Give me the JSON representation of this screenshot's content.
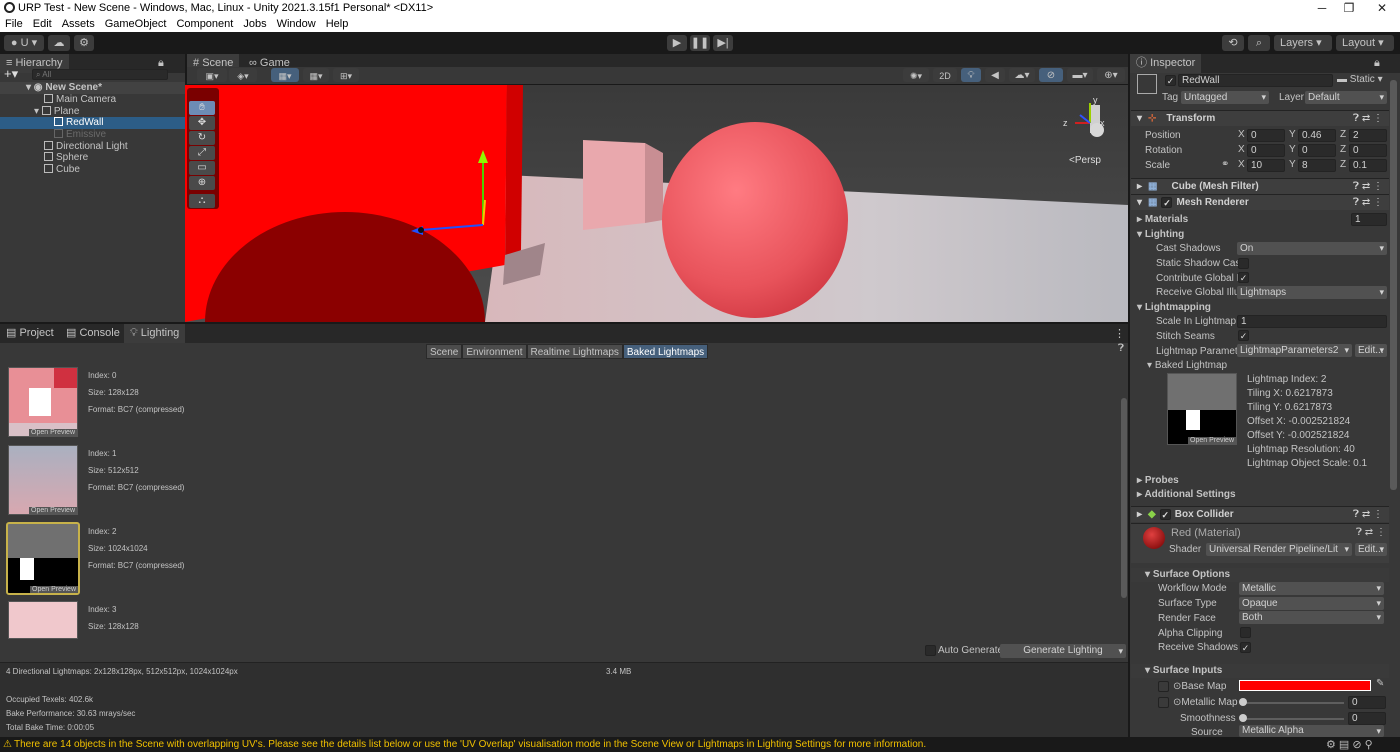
{
  "window": {
    "title": "URP Test - New Scene - Windows, Mac, Linux - Unity 2021.3.15f1 Personal* <DX11>",
    "minimize": "─",
    "maximize": "❐",
    "close": "✕"
  },
  "menu": [
    "File",
    "Edit",
    "Assets",
    "GameObject",
    "Component",
    "Jobs",
    "Window",
    "Help"
  ],
  "toolbar": {
    "account": "U",
    "layers": "Layers",
    "layout": "Layout"
  },
  "hierarchy": {
    "tab": "Hierarchy",
    "search_placeholder": "All",
    "scene": "New Scene*",
    "items": [
      "Main Camera",
      "Plane",
      "RedWall",
      "Emissive",
      "Directional Light",
      "Sphere",
      "Cube"
    ]
  },
  "scene": {
    "tab_scene": "Scene",
    "tab_game": "Game",
    "btn_2d": "2D",
    "persp": "<Persp",
    "axis_y": "y",
    "axis_z": "z",
    "axis_x": "x"
  },
  "bottom": {
    "tabs": [
      "Project",
      "Console",
      "Lighting"
    ],
    "lighting_tabs": [
      "Scene",
      "Environment",
      "Realtime Lightmaps",
      "Baked Lightmaps"
    ],
    "lightmaps": [
      {
        "index": "Index: 0",
        "size": "Size: 128x128",
        "format": "Format: BC7 (compressed)",
        "preview": "Open Preview"
      },
      {
        "index": "Index: 1",
        "size": "Size: 512x512",
        "format": "Format: BC7 (compressed)",
        "preview": "Open Preview"
      },
      {
        "index": "Index: 2",
        "size": "Size: 1024x1024",
        "format": "Format: BC7 (compressed)",
        "preview": "Open Preview"
      },
      {
        "index": "Index: 3",
        "size": "Size: 128x128"
      }
    ],
    "auto_generate": "Auto Generate",
    "generate": "Generate Lighting",
    "summary": "4 Directional Lightmaps: 2x128x128px, 512x512px, 1024x1024px",
    "memory": "3.4 MB",
    "occupied": "Occupied Texels: 402.6k",
    "perf": "Bake Performance: 30.63 mrays/sec",
    "time": "Total Bake Time: 0:00:05"
  },
  "inspector": {
    "tab": "Inspector",
    "name": "RedWall",
    "static": "Static",
    "tag_label": "Tag",
    "tag": "Untagged",
    "layer_label": "Layer",
    "layer": "Default",
    "transform": "Transform",
    "position": "Position",
    "rotation": "Rotation",
    "scale": "Scale",
    "pos": {
      "x": "0",
      "y": "0.46",
      "z": "2"
    },
    "rot": {
      "x": "0",
      "y": "0",
      "z": "0"
    },
    "scl": {
      "x": "10",
      "y": "8",
      "z": "0.1"
    },
    "mesh_filter": "Cube (Mesh Filter)",
    "mesh_renderer": "Mesh Renderer",
    "materials": "Materials",
    "materials_count": "1",
    "lighting": "Lighting",
    "cast_shadows": "Cast Shadows",
    "cast_shadows_val": "On",
    "static_shadow": "Static Shadow Cast",
    "contribute_gi": "Contribute Global Ill",
    "receive_gi": "Receive Global Illun",
    "receive_gi_val": "Lightmaps",
    "lightmapping": "Lightmapping",
    "scale_lm": "Scale In Lightmap",
    "scale_lm_val": "1",
    "stitch": "Stitch Seams",
    "lm_params": "Lightmap Paramete",
    "lm_params_val": "LightmapParameters2",
    "edit": "Edit...",
    "baked_lm": "Baked Lightmap",
    "lm_index": "Lightmap Index: 2",
    "tiling_x": "Tiling X: 0.6217873",
    "tiling_y": "Tiling Y: 0.6217873",
    "offset_x": "Offset X: -0.002521824",
    "offset_y": "Offset Y: -0.002521824",
    "lm_res": "Lightmap Resolution: 40",
    "lm_obj_scale": "Lightmap Object Scale: 0.1",
    "open_preview": "Open Preview",
    "probes": "Probes",
    "additional": "Additional Settings",
    "box_collider": "Box Collider",
    "material": "Red (Material)",
    "shader_label": "Shader",
    "shader": "Universal Render Pipeline/Lit",
    "surface_options": "Surface Options",
    "workflow": "Workflow Mode",
    "workflow_val": "Metallic",
    "surface_type": "Surface Type",
    "surface_type_val": "Opaque",
    "render_face": "Render Face",
    "render_face_val": "Both",
    "alpha_clip": "Alpha Clipping",
    "receive_shadows": "Receive Shadows",
    "surface_inputs": "Surface Inputs",
    "base_map": "Base Map",
    "metallic_map": "Metallic Map",
    "metallic_val": "0",
    "smoothness": "Smoothness",
    "smoothness_val": "0",
    "source": "Source",
    "source_val": "Metallic Alpha"
  },
  "status": {
    "warning": "There are 14 objects in the Scene with overlapping UV's. Please see the details list below or use the 'UV Overlap' visualisation mode in the Scene View or Lightmaps in Lighting Settings for more information."
  },
  "colors": {
    "accent": "#2c5d87",
    "red": "#ff0000",
    "warning": "#f0c000"
  }
}
